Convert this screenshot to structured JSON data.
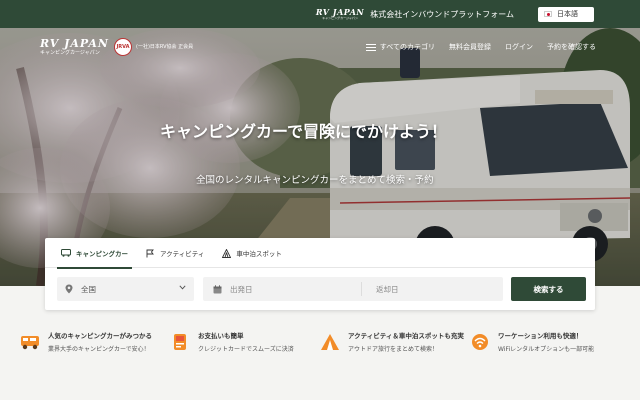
{
  "topbar": {
    "logo_main": "RV JAPAN",
    "logo_sub": "キャンピングカージャパン",
    "company": "株式会社インバウンドプラットフォーム",
    "language": "日本語"
  },
  "header": {
    "logo_main": "RV JAPAN",
    "logo_sub": "キャンピングカージャパン",
    "assoc_emblem": "JRVA",
    "assoc_text": "(一社)日本RV協会 正会員"
  },
  "nav": {
    "categories": "すべてのカテゴリ",
    "register": "無料会員登録",
    "login": "ログイン",
    "reservations": "予約を確認する"
  },
  "hero": {
    "title": "キャンピングカーで冒険にでかけよう！",
    "subtitle": "全国のレンタルキャンピングカーをまとめて検索・予約"
  },
  "tabs": [
    {
      "label": "キャンピングカー",
      "icon": "van-icon",
      "active": true
    },
    {
      "label": "アクティビティ",
      "icon": "flag-icon",
      "active": false
    },
    {
      "label": "車中泊スポット",
      "icon": "tent-icon",
      "active": false
    }
  ],
  "search": {
    "area": "全国",
    "departure_placeholder": "出発日",
    "return_placeholder": "返却日",
    "button": "検索する"
  },
  "features": [
    {
      "title": "人気のキャンピングカーがみつかる",
      "desc": "業界大手のキャンピングカーで安心！",
      "icon": "camper-icon"
    },
    {
      "title": "お支払いも簡単",
      "desc": "クレジットカードでスムーズに決済",
      "icon": "card-icon"
    },
    {
      "title": "アクティビティ＆車中泊スポットも充実",
      "desc": "アウトドア旅行をまとめて検索！",
      "icon": "tent-icon"
    },
    {
      "title": "ワーケーション利用も快適！",
      "desc": "WiFiレンタルオプションも一部可能",
      "icon": "wifi-icon"
    }
  ],
  "colors": {
    "brand": "#2f4a37",
    "accent": "#f28c28"
  }
}
